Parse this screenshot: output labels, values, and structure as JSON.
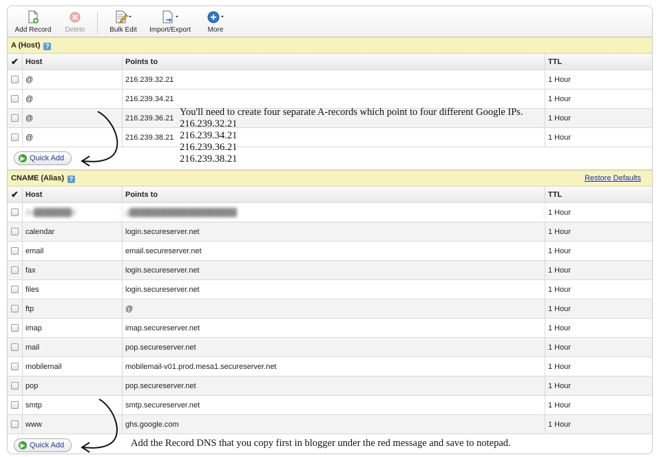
{
  "toolbar": {
    "add_record": "Add Record",
    "delete": "Delete",
    "bulk_edit": "Bulk Edit",
    "import_export": "Import/Export",
    "more": "More"
  },
  "a_section": {
    "title": "A (Host)",
    "columns": {
      "host": "Host",
      "points_to": "Points to",
      "ttl": "TTL"
    },
    "rows": [
      {
        "host": "@",
        "points_to": "216.239.32.21",
        "ttl": "1 Hour"
      },
      {
        "host": "@",
        "points_to": "216.239.34.21",
        "ttl": "1 Hour"
      },
      {
        "host": "@",
        "points_to": "216.239.36.21",
        "ttl": "1 Hour"
      },
      {
        "host": "@",
        "points_to": "216.239.38.21",
        "ttl": "1 Hour"
      }
    ],
    "quick_add": "Quick Add"
  },
  "cname_section": {
    "title": "CNAME (Alias)",
    "restore_defaults": "Restore Defaults",
    "columns": {
      "host": "Host",
      "points_to": "Points to",
      "ttl": "TTL"
    },
    "rows": [
      {
        "host": "2u███████d",
        "points_to": "g████████████████████",
        "ttl": "1 Hour"
      },
      {
        "host": "calendar",
        "points_to": "login.secureserver.net",
        "ttl": "1 Hour"
      },
      {
        "host": "email",
        "points_to": "email.secureserver.net",
        "ttl": "1 Hour"
      },
      {
        "host": "fax",
        "points_to": "login.secureserver.net",
        "ttl": "1 Hour"
      },
      {
        "host": "files",
        "points_to": "login.secureserver.net",
        "ttl": "1 Hour"
      },
      {
        "host": "ftp",
        "points_to": "@",
        "ttl": "1 Hour"
      },
      {
        "host": "imap",
        "points_to": "imap.secureserver.net",
        "ttl": "1 Hour"
      },
      {
        "host": "mail",
        "points_to": "pop.secureserver.net",
        "ttl": "1 Hour"
      },
      {
        "host": "mobilemail",
        "points_to": "mobilemail-v01.prod.mesa1.secureserver.net",
        "ttl": "1 Hour"
      },
      {
        "host": "pop",
        "points_to": "pop.secureserver.net",
        "ttl": "1 Hour"
      },
      {
        "host": "smtp",
        "points_to": "smtp.secureserver.net",
        "ttl": "1 Hour"
      },
      {
        "host": "www",
        "points_to": "ghs.google.com",
        "ttl": "1 Hour"
      }
    ],
    "quick_add": "Quick Add"
  },
  "annotations": {
    "a_note": "You'll need to create four separate A-records which point to four different Google IPs.",
    "a_ips": [
      "216.239.32.21",
      "216.239.34.21",
      "216.239.36.21",
      "216.239.38.21"
    ],
    "cname_note": "Add the Record DNS that you copy first in blogger under the red message and save to notepad."
  },
  "icons": {
    "add_record": "add-document-icon",
    "delete": "delete-icon",
    "bulk_edit": "edit-document-icon",
    "import_export": "import-export-icon",
    "more": "more-icon",
    "help": "help-icon",
    "quick_add": "plus-circle-icon",
    "checkmark": "checkmark-icon"
  },
  "colors": {
    "section_header_bg": "#f7f3bd",
    "link": "#1a2ea8",
    "quick_add_text": "#1a3d9a"
  }
}
